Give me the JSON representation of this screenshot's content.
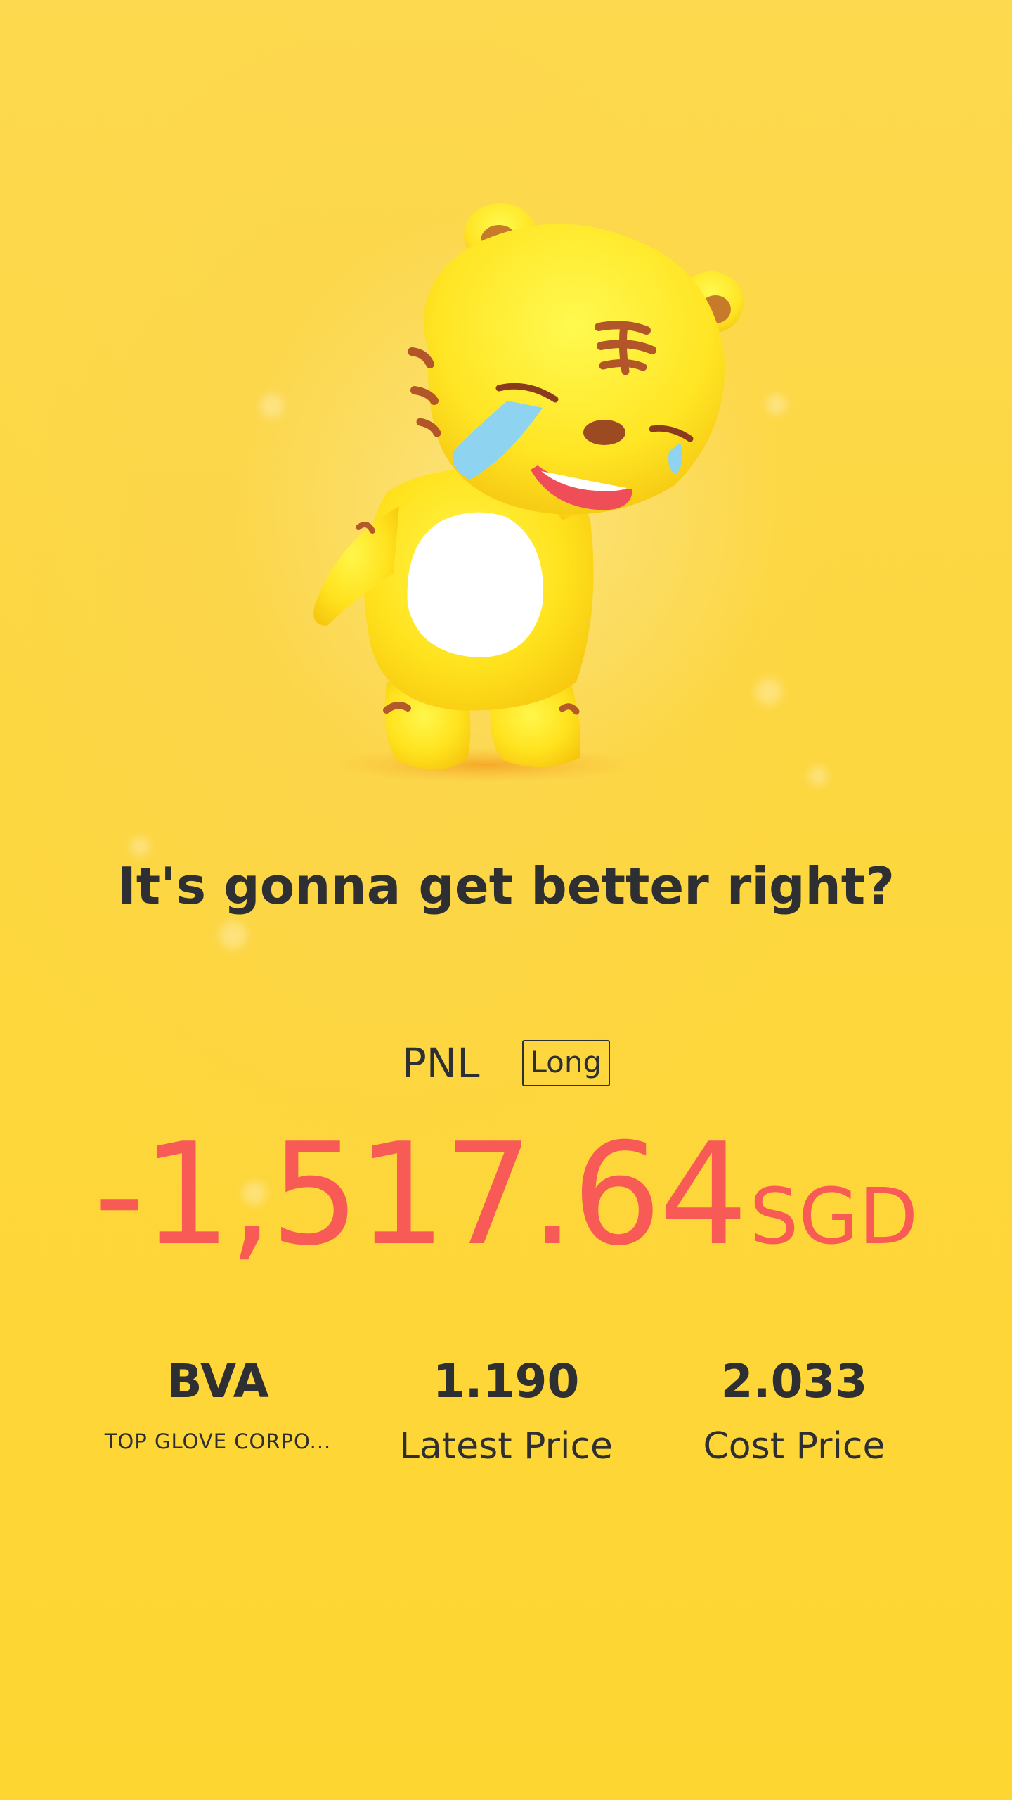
{
  "colors": {
    "background": "#fdd740",
    "text": "#2e2f33",
    "loss": "#f85a56"
  },
  "mascot": {
    "icon": "crying-tiger-mascot-icon"
  },
  "headline": "It's gonna get better right?",
  "pnl": {
    "label": "PNL",
    "direction": "Long",
    "amount": "-1,517.64",
    "currency": "SGD"
  },
  "stock": {
    "symbol": "BVA",
    "name": "TOP GLOVE CORPO..."
  },
  "latest_price": {
    "value": "1.190",
    "label": "Latest Price"
  },
  "cost_price": {
    "value": "2.033",
    "label": "Cost Price"
  }
}
